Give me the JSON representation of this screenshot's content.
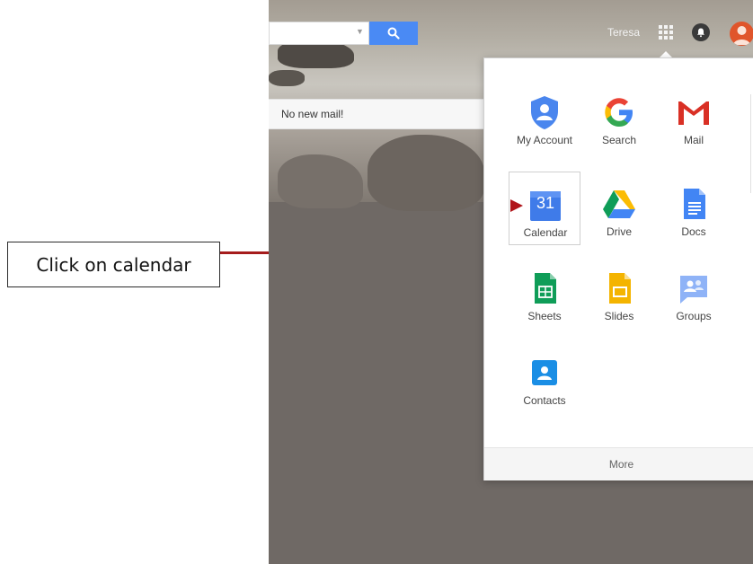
{
  "annotation": {
    "text": "Click on calendar"
  },
  "header": {
    "user_name": "Teresa",
    "search_button_icon": "search-icon",
    "apps_icon": "apps-grid-icon",
    "notifications_icon": "bell-icon",
    "avatar_icon": "user-avatar-icon"
  },
  "mail": {
    "status": "No new mail!"
  },
  "launcher": {
    "apps": [
      {
        "label": "My Account",
        "icon": "account-shield-icon"
      },
      {
        "label": "Search",
        "icon": "google-g-icon"
      },
      {
        "label": "Mail",
        "icon": "gmail-icon"
      },
      {
        "label": "Calendar",
        "icon": "calendar-icon",
        "day": "31"
      },
      {
        "label": "Drive",
        "icon": "drive-icon"
      },
      {
        "label": "Docs",
        "icon": "docs-icon"
      },
      {
        "label": "Sheets",
        "icon": "sheets-icon"
      },
      {
        "label": "Slides",
        "icon": "slides-icon"
      },
      {
        "label": "Groups",
        "icon": "groups-icon"
      },
      {
        "label": "Contacts",
        "icon": "contacts-icon"
      }
    ],
    "more_label": "More"
  },
  "colors": {
    "annotation_line": "#a51c1c",
    "search_blue": "#4a8af4",
    "avatar_orange": "#e0552b"
  }
}
